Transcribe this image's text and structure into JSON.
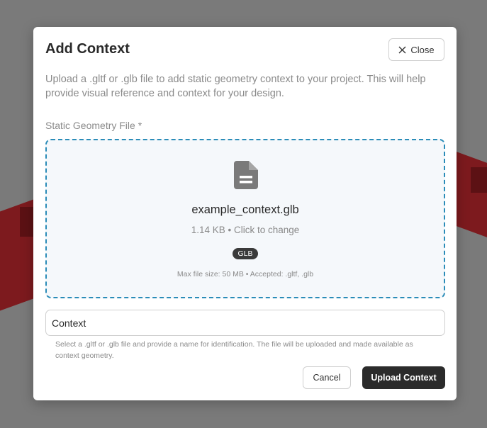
{
  "modal": {
    "title": "Add Context",
    "close_label": "Close",
    "description": "Upload a .gltf or .glb file to add static geometry context to your project. This will help provide visual reference and context for your design.",
    "field_label": "Static Geometry File *"
  },
  "dropzone": {
    "file_name": "example_context.glb",
    "file_meta": "1.14 KB • Click to change",
    "badge": "GLB",
    "limits": "Max file size: 50 MB • Accepted: .gltf, .glb",
    "icon": "file-icon"
  },
  "name_field": {
    "value": "Context"
  },
  "help_text": "Select a .gltf or .glb file and provide a name for identification. The file will be uploaded and made available as context geometry.",
  "actions": {
    "cancel_label": "Cancel",
    "upload_label": "Upload Context"
  },
  "colors": {
    "backdrop": "#7a7a7a",
    "geometry": "#7d1a1e",
    "dropzone_border": "#2a8cb8",
    "primary_button": "#2b2b2b"
  }
}
